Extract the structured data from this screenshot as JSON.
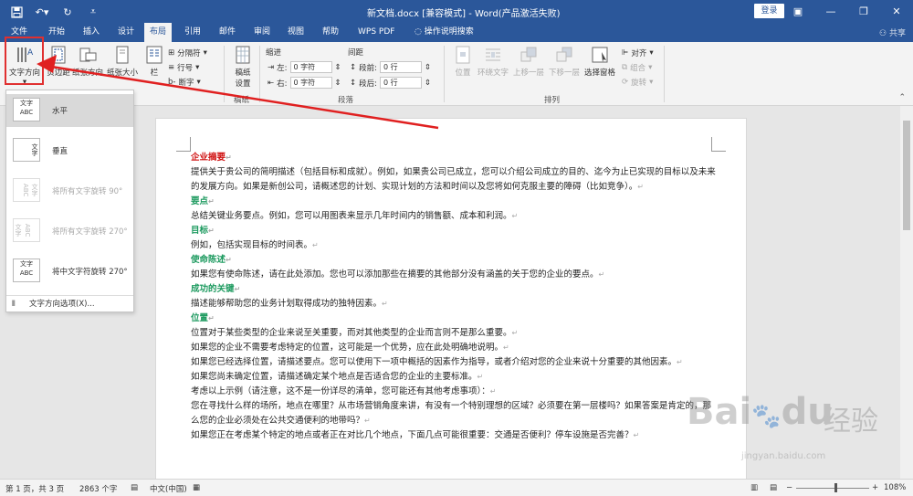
{
  "window": {
    "title": "新文档.docx [兼容模式] - Word(产品激活失败)",
    "login_label": "登录"
  },
  "tabs": [
    {
      "label": "文件"
    },
    {
      "label": "开始"
    },
    {
      "label": "插入"
    },
    {
      "label": "设计"
    },
    {
      "label": "布局"
    },
    {
      "label": "引用"
    },
    {
      "label": "邮件"
    },
    {
      "label": "审阅"
    },
    {
      "label": "视图"
    },
    {
      "label": "帮助"
    },
    {
      "label": "WPS PDF"
    },
    {
      "label": "操作说明搜索"
    }
  ],
  "share_label": "共享",
  "ribbon": {
    "text_direction": "文字方向",
    "margins": "页边距",
    "orientation": "纸张方向",
    "size": "纸张大小",
    "columns": "栏",
    "breaks": "分隔符",
    "line_numbers": "行号",
    "hyphenation": "断字",
    "draft_paper_1": "稿纸",
    "draft_paper_2": "设置",
    "draft_paper_group": "稿纸",
    "indent_label": "缩进",
    "spacing_label": "间距",
    "indent_left_label": "左:",
    "indent_left_value": "0 字符",
    "indent_right_label": "右:",
    "indent_right_value": "0 字符",
    "space_before_label": "段前:",
    "space_before_value": "0 行",
    "space_after_label": "段后:",
    "space_after_value": "0 行",
    "paragraph_group": "段落",
    "position": "位置",
    "wrap_text": "环绕文字",
    "bring_forward": "上移一层",
    "send_backward": "下移一层",
    "selection_pane": "选择窗格",
    "align": "对齐",
    "group": "组合",
    "rotate": "旋转",
    "arrange_group": "排列"
  },
  "dropdown": {
    "items": [
      {
        "label": "水平",
        "thumb": "文字 ABC"
      },
      {
        "label": "垂直",
        "thumb": "文字"
      },
      {
        "label": "将所有文字旋转 90°",
        "thumb": "文字 ABC"
      },
      {
        "label": "将所有文字旋转 270°",
        "thumb": "文字 ABC"
      },
      {
        "label": "将中文字符旋转 270°",
        "thumb": "文字 ABC"
      }
    ],
    "options_label": "文字方向选项(X)..."
  },
  "document": {
    "paragraphs": [
      {
        "type": "h",
        "red": true,
        "text": "企业摘要"
      },
      {
        "type": "p",
        "text": "提供关于贵公司的简明描述（包括目标和成就）。例如，如果贵公司已成立，您可以介绍公司成立的目的、迄今为止已实现的目标以及未来的发展方向。如果是新创公司，请概述您的计划、实现计划的方法和时间以及您将如何克服主要的障碍（比如竞争）。"
      },
      {
        "type": "h",
        "text": "要点"
      },
      {
        "type": "p",
        "text": "总结关键业务要点。例如，您可以用图表来显示几年时间内的销售额、成本和利润。"
      },
      {
        "type": "h",
        "text": "目标"
      },
      {
        "type": "p",
        "text": "例如，包括实现目标的时间表。"
      },
      {
        "type": "h",
        "text": "使命陈述"
      },
      {
        "type": "p",
        "text": "如果您有使命陈述，请在此处添加。您也可以添加那些在摘要的其他部分没有涵盖的关于您的企业的要点。"
      },
      {
        "type": "h",
        "text": "成功的关键"
      },
      {
        "type": "p",
        "text": "描述能够帮助您的业务计划取得成功的独特因素。"
      },
      {
        "type": "h",
        "text": "位置"
      },
      {
        "type": "p",
        "text": "位置对于某些类型的企业来说至关重要，而对其他类型的企业而言则不是那么重要。"
      },
      {
        "type": "p",
        "text": "如果您的企业不需要考虑特定的位置，这可能是一个优势，应在此处明确地说明。"
      },
      {
        "type": "p",
        "text": "如果您已经选择位置，请描述要点。您可以使用下一项中概括的因素作为指导，或者介绍对您的企业来说十分重要的其他因素。"
      },
      {
        "type": "p",
        "text": "如果您尚未确定位置，请描述确定某个地点是否适合您的企业的主要标准。"
      },
      {
        "type": "p",
        "text": "考虑以上示例（请注意，这不是一份详尽的清单，您可能还有其他考虑事项）："
      },
      {
        "type": "p",
        "text": "您在寻找什么样的场所，地点在哪里？从市场营销角度来讲，有没有一个特别理想的区域？必须要在第一层楼吗？如果答案是肯定的，那么您的企业必须处在公共交通便利的地带吗？"
      },
      {
        "type": "p",
        "text": "如果您正在考虑某个特定的地点或者正在对比几个地点，下面几点可能很重要：交通是否便利？停车设施是否完善？"
      }
    ]
  },
  "status": {
    "page": "第 1 页，共 3 页",
    "words": "2863 个字",
    "language": "中文(中国)",
    "zoom": "108%"
  },
  "watermark": {
    "brand": "Bai",
    "brand2": "du",
    "cn": "经验",
    "url": "jingyan.baidu.com"
  }
}
